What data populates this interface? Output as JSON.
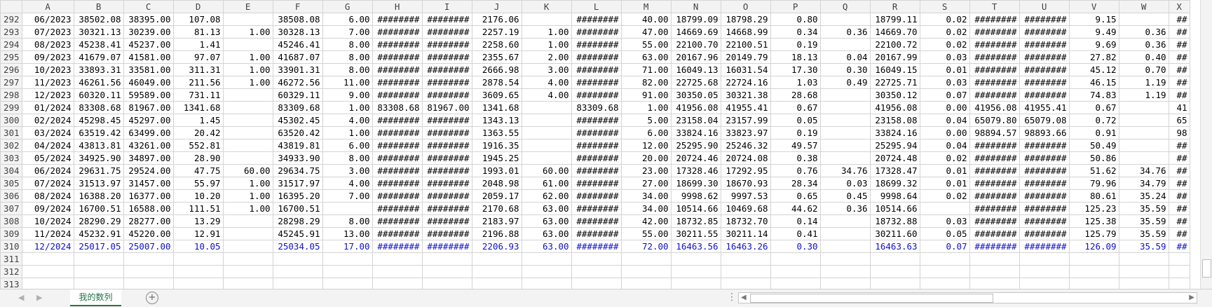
{
  "columns": [
    "A",
    "B",
    "C",
    "D",
    "E",
    "F",
    "G",
    "H",
    "I",
    "J",
    "K",
    "L",
    "M",
    "N",
    "O",
    "P",
    "Q",
    "R",
    "S",
    "T",
    "U",
    "V",
    "W",
    "X"
  ],
  "rows": [
    {
      "n": "292",
      "c": [
        "06/2023",
        "38502.08",
        "38395.00",
        "107.08",
        "",
        "38508.08",
        "6.00",
        "########",
        "########",
        "2176.06",
        "",
        "########",
        "40.00",
        "18799.09",
        "18798.29",
        "0.80",
        "",
        "18799.11",
        "0.02",
        "########",
        "########",
        "9.15",
        "",
        "##"
      ]
    },
    {
      "n": "293",
      "c": [
        "07/2023",
        "30321.13",
        "30239.00",
        "81.13",
        "1.00",
        "30328.13",
        "7.00",
        "########",
        "########",
        "2257.19",
        "1.00",
        "########",
        "47.00",
        "14669.69",
        "14668.99",
        "0.34",
        "0.36",
        "14669.70",
        "0.02",
        "########",
        "########",
        "9.49",
        "0.36",
        "##"
      ]
    },
    {
      "n": "294",
      "c": [
        "08/2023",
        "45238.41",
        "45237.00",
        "1.41",
        "",
        "45246.41",
        "8.00",
        "########",
        "########",
        "2258.60",
        "1.00",
        "########",
        "55.00",
        "22100.70",
        "22100.51",
        "0.19",
        "",
        "22100.72",
        "0.02",
        "########",
        "########",
        "9.69",
        "0.36",
        "##"
      ]
    },
    {
      "n": "295",
      "c": [
        "09/2023",
        "41679.07",
        "41581.00",
        "97.07",
        "1.00",
        "41687.07",
        "8.00",
        "########",
        "########",
        "2355.67",
        "2.00",
        "########",
        "63.00",
        "20167.96",
        "20149.79",
        "18.13",
        "0.04",
        "20167.99",
        "0.03",
        "########",
        "########",
        "27.82",
        "0.40",
        "##"
      ]
    },
    {
      "n": "296",
      "c": [
        "10/2023",
        "33893.31",
        "33581.00",
        "311.31",
        "1.00",
        "33901.31",
        "8.00",
        "########",
        "########",
        "2666.98",
        "3.00",
        "########",
        "71.00",
        "16049.13",
        "16031.54",
        "17.30",
        "0.30",
        "16049.15",
        "0.01",
        "########",
        "########",
        "45.12",
        "0.70",
        "##"
      ]
    },
    {
      "n": "297",
      "c": [
        "11/2023",
        "46261.56",
        "46049.00",
        "211.56",
        "1.00",
        "46272.56",
        "11.00",
        "########",
        "########",
        "2878.54",
        "4.00",
        "########",
        "82.00",
        "22725.68",
        "22724.16",
        "1.03",
        "0.49",
        "22725.71",
        "0.03",
        "########",
        "########",
        "46.15",
        "1.19",
        "##"
      ]
    },
    {
      "n": "298",
      "c": [
        "12/2023",
        "60320.11",
        "59589.00",
        "731.11",
        "",
        "60329.11",
        "9.00",
        "########",
        "########",
        "3609.65",
        "4.00",
        "########",
        "91.00",
        "30350.05",
        "30321.38",
        "28.68",
        "",
        "30350.12",
        "0.07",
        "########",
        "########",
        "74.83",
        "1.19",
        "##"
      ]
    },
    {
      "n": "299",
      "c": [
        "01/2024",
        "83308.68",
        "81967.00",
        "1341.68",
        "",
        "83309.68",
        "1.00",
        "83308.68",
        "81967.00",
        "1341.68",
        "",
        "83309.68",
        "1.00",
        "41956.08",
        "41955.41",
        "0.67",
        "",
        "41956.08",
        "0.00",
        "41956.08",
        "41955.41",
        "0.67",
        "",
        "41"
      ]
    },
    {
      "n": "300",
      "c": [
        "02/2024",
        "45298.45",
        "45297.00",
        "1.45",
        "",
        "45302.45",
        "4.00",
        "########",
        "########",
        "1343.13",
        "",
        "########",
        "5.00",
        "23158.04",
        "23157.99",
        "0.05",
        "",
        "23158.08",
        "0.04",
        "65079.80",
        "65079.08",
        "0.72",
        "",
        "65"
      ]
    },
    {
      "n": "301",
      "c": [
        "03/2024",
        "63519.42",
        "63499.00",
        "20.42",
        "",
        "63520.42",
        "1.00",
        "########",
        "########",
        "1363.55",
        "",
        "########",
        "6.00",
        "33824.16",
        "33823.97",
        "0.19",
        "",
        "33824.16",
        "0.00",
        "98894.57",
        "98893.66",
        "0.91",
        "",
        "98"
      ]
    },
    {
      "n": "302",
      "c": [
        "04/2024",
        "43813.81",
        "43261.00",
        "552.81",
        "",
        "43819.81",
        "6.00",
        "########",
        "########",
        "1916.35",
        "",
        "########",
        "12.00",
        "25295.90",
        "25246.32",
        "49.57",
        "",
        "25295.94",
        "0.04",
        "########",
        "########",
        "50.49",
        "",
        "##"
      ]
    },
    {
      "n": "303",
      "c": [
        "05/2024",
        "34925.90",
        "34897.00",
        "28.90",
        "",
        "34933.90",
        "8.00",
        "########",
        "########",
        "1945.25",
        "",
        "########",
        "20.00",
        "20724.46",
        "20724.08",
        "0.38",
        "",
        "20724.48",
        "0.02",
        "########",
        "########",
        "50.86",
        "",
        "##"
      ]
    },
    {
      "n": "304",
      "c": [
        "06/2024",
        "29631.75",
        "29524.00",
        "47.75",
        "60.00",
        "29634.75",
        "3.00",
        "########",
        "########",
        "1993.01",
        "60.00",
        "########",
        "23.00",
        "17328.46",
        "17292.95",
        "0.76",
        "34.76",
        "17328.47",
        "0.01",
        "########",
        "########",
        "51.62",
        "34.76",
        "##"
      ]
    },
    {
      "n": "305",
      "c": [
        "07/2024",
        "31513.97",
        "31457.00",
        "55.97",
        "1.00",
        "31517.97",
        "4.00",
        "########",
        "########",
        "2048.98",
        "61.00",
        "########",
        "27.00",
        "18699.30",
        "18670.93",
        "28.34",
        "0.03",
        "18699.32",
        "0.01",
        "########",
        "########",
        "79.96",
        "34.79",
        "##"
      ]
    },
    {
      "n": "306",
      "c": [
        "08/2024",
        "16388.20",
        "16377.00",
        "10.20",
        "1.00",
        "16395.20",
        "7.00",
        "########",
        "########",
        "2059.17",
        "62.00",
        "########",
        "34.00",
        "9998.62",
        "9997.53",
        "0.65",
        "0.45",
        "9998.64",
        "0.02",
        "########",
        "########",
        "80.61",
        "35.24",
        "##"
      ]
    },
    {
      "n": "307",
      "c": [
        "09/2024",
        "16700.51",
        "16588.00",
        "111.51",
        "1.00",
        "16700.51",
        "",
        "########",
        "########",
        "2170.68",
        "63.00",
        "########",
        "34.00",
        "10514.66",
        "10469.68",
        "44.62",
        "0.36",
        "10514.66",
        "",
        "########",
        "########",
        "125.23",
        "35.59",
        "##"
      ]
    },
    {
      "n": "308",
      "c": [
        "10/2024",
        "28290.29",
        "28277.00",
        "13.29",
        "",
        "28298.29",
        "8.00",
        "########",
        "########",
        "2183.97",
        "63.00",
        "########",
        "42.00",
        "18732.85",
        "18732.70",
        "0.14",
        "",
        "18732.88",
        "0.03",
        "########",
        "########",
        "125.38",
        "35.59",
        "##"
      ]
    },
    {
      "n": "309",
      "c": [
        "11/2024",
        "45232.91",
        "45220.00",
        "12.91",
        "",
        "45245.91",
        "13.00",
        "########",
        "########",
        "2196.88",
        "63.00",
        "########",
        "55.00",
        "30211.55",
        "30211.14",
        "0.41",
        "",
        "30211.60",
        "0.05",
        "########",
        "########",
        "125.79",
        "35.59",
        "##"
      ]
    },
    {
      "n": "310",
      "c": [
        "12/2024",
        "25017.05",
        "25007.00",
        "10.05",
        "",
        "25034.05",
        "17.00",
        "########",
        "########",
        "2206.93",
        "63.00",
        "########",
        "72.00",
        "16463.56",
        "16463.26",
        "0.30",
        "",
        "16463.63",
        "0.07",
        "########",
        "########",
        "126.09",
        "35.59",
        "##"
      ],
      "blue": true
    },
    {
      "n": "311",
      "c": [
        "",
        "",
        "",
        "",
        "",
        "",
        "",
        "",
        "",
        "",
        "",
        "",
        "",
        "",
        "",
        "",
        "",
        "",
        "",
        "",
        "",
        "",
        "",
        ""
      ]
    },
    {
      "n": "312",
      "c": [
        "",
        "",
        "",
        "",
        "",
        "",
        "",
        "",
        "",
        "",
        "",
        "",
        "",
        "",
        "",
        "",
        "",
        "",
        "",
        "",
        "",
        "",
        "",
        ""
      ]
    },
    {
      "n": "313",
      "c": [
        "",
        "",
        "",
        "",
        "",
        "",
        "",
        "",
        "",
        "",
        "",
        "",
        "",
        "",
        "",
        "",
        "",
        "",
        "",
        "",
        "",
        "",
        "",
        ""
      ]
    }
  ],
  "sheet_tabs": [
    {
      "label": "我的数列",
      "active": true
    }
  ],
  "colors": {
    "accent": "#217346",
    "blue_row": "#1010d0",
    "header_bg": "#f3f3f3",
    "gridline": "#d4d4d4"
  },
  "icons": {
    "add_sheet": "plus-circle-icon",
    "prev": "chevron-left-icon",
    "next": "chevron-right-icon",
    "more": "more-dots-icon"
  }
}
